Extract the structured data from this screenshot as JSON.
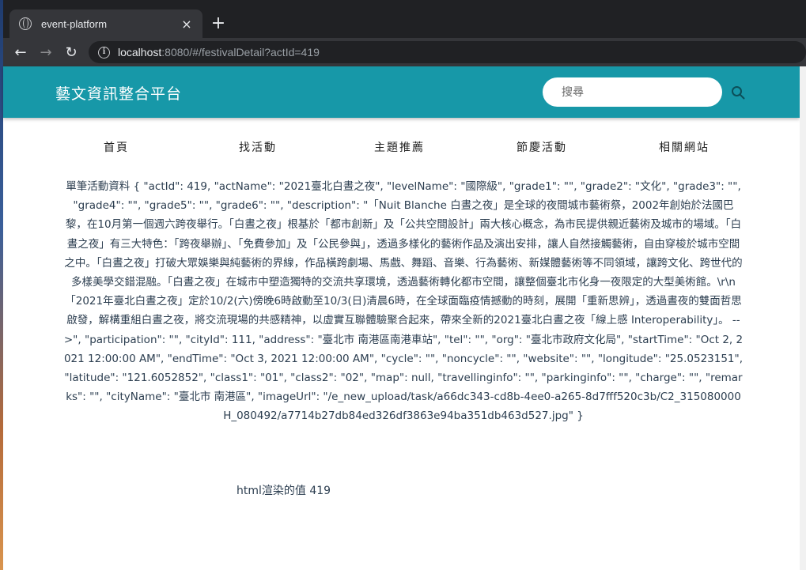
{
  "browser": {
    "tab_title": "event-platform",
    "tab_close": "×",
    "new_tab": "+",
    "url_host": "localhost",
    "url_rest": ":8080/#/festivalDetail?actId=419"
  },
  "header": {
    "brand": "藝文資訊整合平台",
    "search_placeholder": "搜尋",
    "accent_color": "#1798a8"
  },
  "nav": {
    "items": [
      {
        "label": "首頁"
      },
      {
        "label": "找活動"
      },
      {
        "label": "主題推薦"
      },
      {
        "label": "節慶活動"
      },
      {
        "label": "相關網站"
      }
    ]
  },
  "main": {
    "raw_text": "單筆活動資料 { \"actId\": 419, \"actName\": \"2021臺北白晝之夜\", \"levelName\": \"國際級\", \"grade1\": \"\", \"grade2\": \"文化\", \"grade3\": \"\", \"grade4\": \"\", \"grade5\": \"\", \"grade6\": \"\", \"description\": \"「Nuit Blanche 白晝之夜」是全球的夜間城市藝術祭，2002年創始於法國巴黎，在10月第一個週六跨夜舉行。「白晝之夜」根基於「都市創新」及「公共空間設計」兩大核心概念，為市民提供親近藝術及城市的場域。「白晝之夜」有三大特色：「跨夜舉辦」、「免費參加」及「公民參與」，透過多樣化的藝術作品及演出安排，讓人自然接觸藝術，自由穿梭於城市空間之中。「白晝之夜」打破大眾娛樂與純藝術的界線，作品橫跨劇場、馬戲、舞蹈、音樂、行為藝術、新媒體藝術等不同領域，讓跨文化、跨世代的多樣美學交錯混融。「白晝之夜」在城市中塑造獨特的交流共享環境，透過藝術轉化都市空間，讓整個臺北市化身一夜限定的大型美術館。\\r\\n「2021年臺北白晝之夜」定於10/2(六)傍晚6時啟動至10/3(日)清晨6時，在全球面臨疫情撼動的時刻，展開「重新思辨」，透過晝夜的雙面哲思啟發，解構重組白晝之夜，將交流現場的共感精神，以虛實互聯體驗聚合起來，帶來全新的2021臺北白晝之夜「線上感 Interoperability」。 -->\", \"participation\": \"\", \"cityId\": 111, \"address\": \"臺北市 南港區南港車站\", \"tel\": \"\", \"org\": \"臺北市政府文化局\", \"startTime\": \"Oct 2, 2021 12:00:00 AM\", \"endTime\": \"Oct 3, 2021 12:00:00 AM\", \"cycle\": \"\", \"noncycle\": \"\", \"website\": \"\", \"longitude\": \"25.0523151\", \"latitude\": \"121.6052852\", \"class1\": \"01\", \"class2\": \"02\", \"map\": null, \"travellinginfo\": \"\", \"parkinginfo\": \"\", \"charge\": \"\", \"remarks\": \"\", \"cityName\": \"臺北市 南港區\", \"imageUrl\": \"/e_new_upload/task/a66dc343-cd8b-4ee0-a265-8d7fff520c3b/C2_315080000H_080492/a7714b27db84ed326df3863e94ba351db463d527.jpg\" }",
    "rendered_value": "html渲染的值 419"
  }
}
